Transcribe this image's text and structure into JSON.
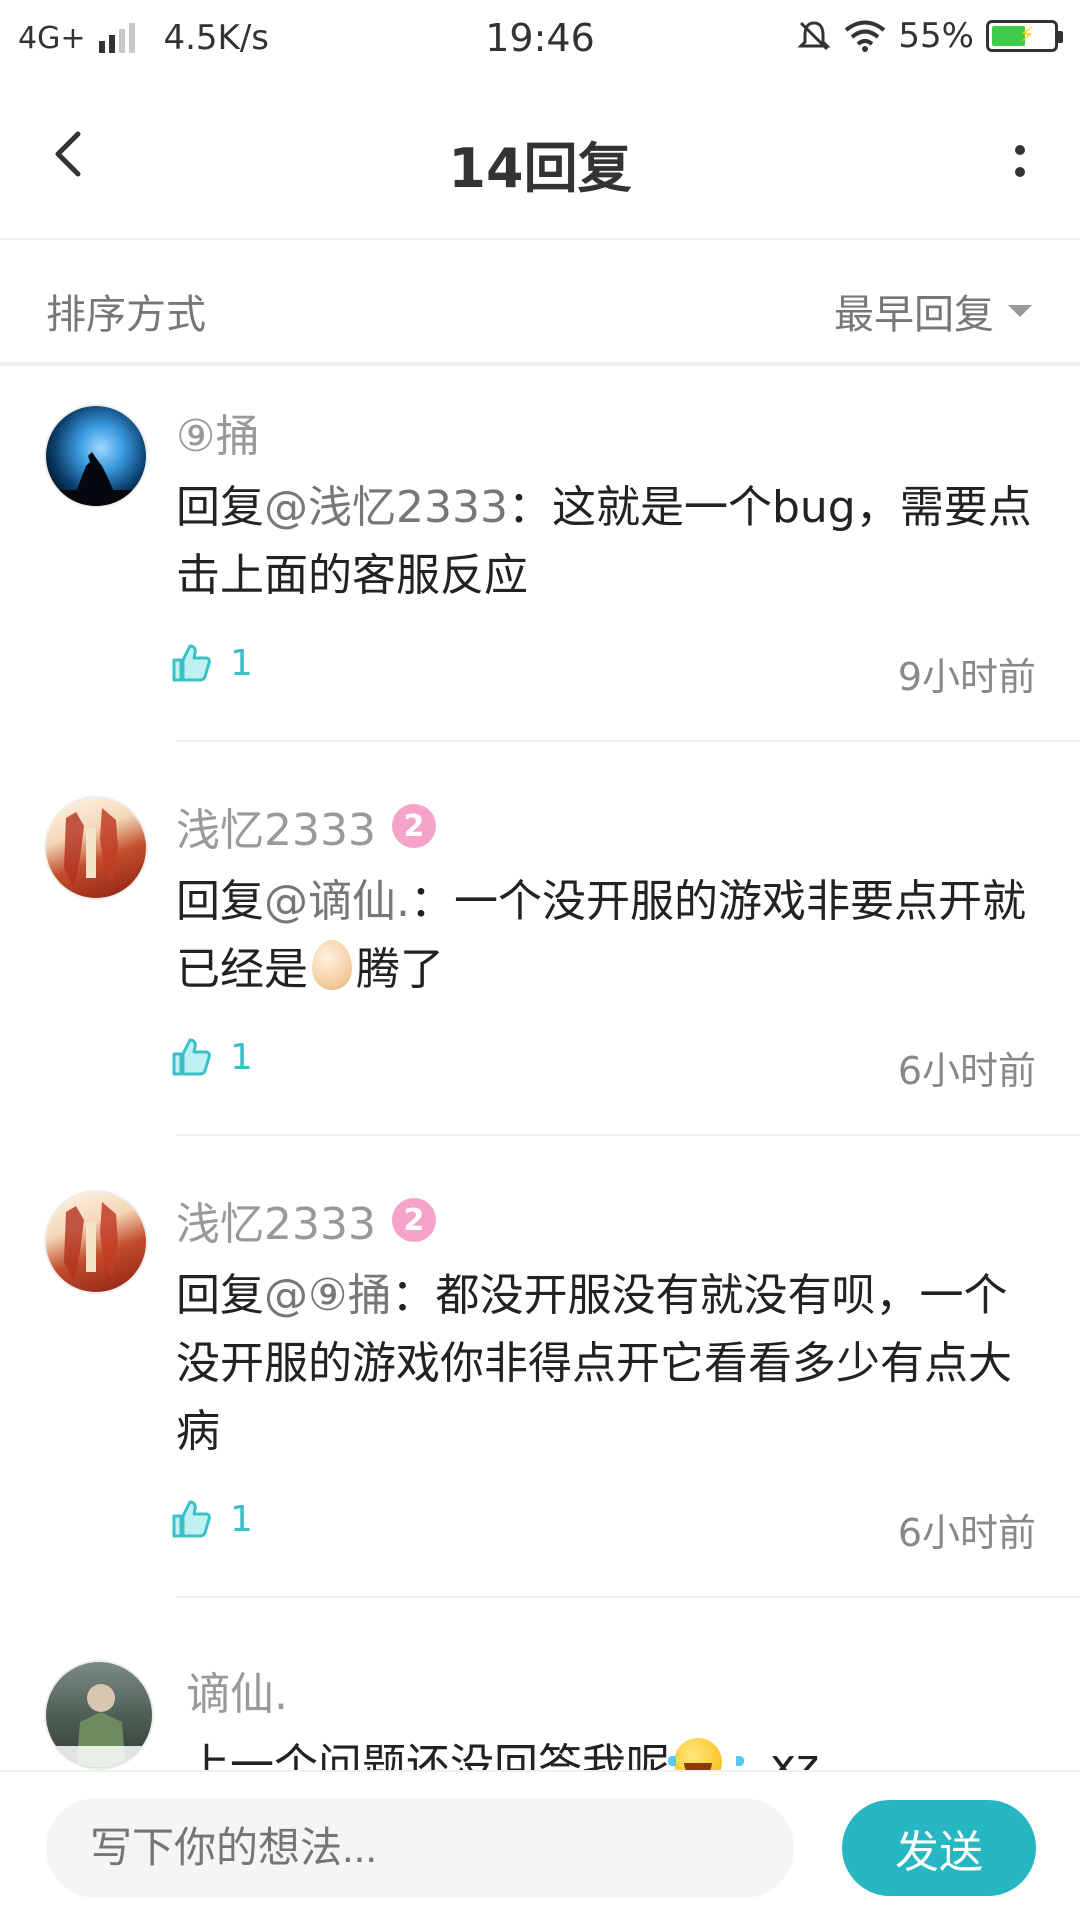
{
  "status_bar": {
    "network": "4G+",
    "speed": "4.5K/s",
    "time": "19:46",
    "battery": "55%",
    "battery_level": 0.55
  },
  "header": {
    "title": "14回复"
  },
  "sort": {
    "label": "排序方式",
    "value": "最早回复"
  },
  "comments": [
    {
      "name": "⑨捅",
      "badge": "",
      "reply_prefix": "回复",
      "mention": "@浅忆2333",
      "text": "：这就是一个bug，需要点击上面的客服反应",
      "likes": "1",
      "time": "9小时前"
    },
    {
      "name": "浅忆2333",
      "badge": "2",
      "reply_prefix": "回复",
      "mention": "@谪仙.",
      "text_a": "：一个没开服的游戏非要点开就已经是",
      "text_b": "腾了",
      "likes": "1",
      "time": "6小时前"
    },
    {
      "name": "浅忆2333",
      "badge": "2",
      "reply_prefix": "回复",
      "mention": "@⑨捅",
      "text": "：都没开服没有就没有呗，一个没开服的游戏你非得点开它看看多少有点大病",
      "likes": "1",
      "time": "6小时前"
    },
    {
      "name": "谪仙.",
      "text_a": "上一个问题还没回答我呢",
      "text_b": "，xz"
    }
  ],
  "input": {
    "placeholder": "写下你的想法...",
    "send_label": "发送"
  },
  "colors": {
    "accent": "#26b7c3",
    "like": "#3cc0c8",
    "badge": "#f5a3c8"
  },
  "icons": [
    "back-icon",
    "more-icon",
    "caret-down-icon",
    "like-icon",
    "signal-icon",
    "wifi-icon",
    "mute-icon",
    "battery-icon"
  ]
}
